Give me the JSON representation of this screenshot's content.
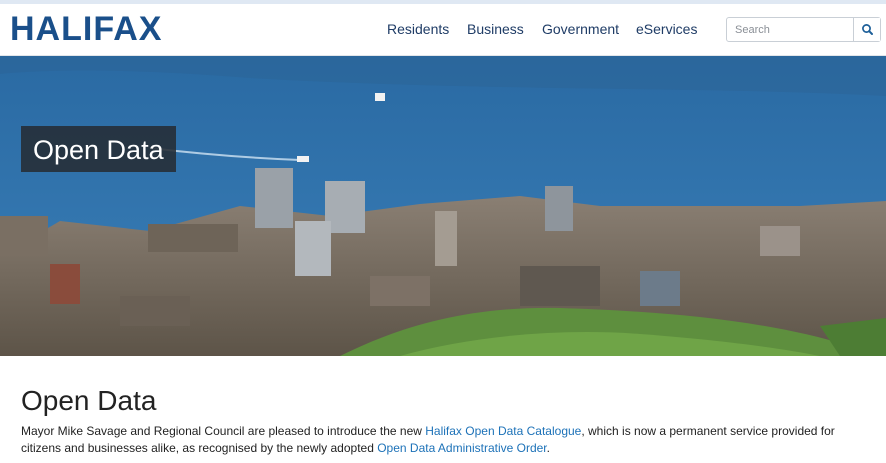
{
  "header": {
    "logo": "HALIFAX",
    "nav": [
      "Residents",
      "Business",
      "Government",
      "eServices"
    ],
    "search_placeholder": "Search",
    "search_icon": "magnifier-icon"
  },
  "hero": {
    "title": "Open Data"
  },
  "main": {
    "title": "Open Data",
    "intro_1": "Mayor Mike Savage and Regional Council are pleased to introduce the new ",
    "link_1": "Halifax Open Data Catalogue",
    "intro_2": ", which is now a permanent service provided for citizens and businesses alike, as recognised by the newly adopted ",
    "link_2": "Open Data Administrative Order",
    "intro_3": "."
  },
  "colors": {
    "brand": "#1a4f8a",
    "nav": "#1f3c66",
    "link": "#1d72b8",
    "water": "#2f6ea6"
  }
}
